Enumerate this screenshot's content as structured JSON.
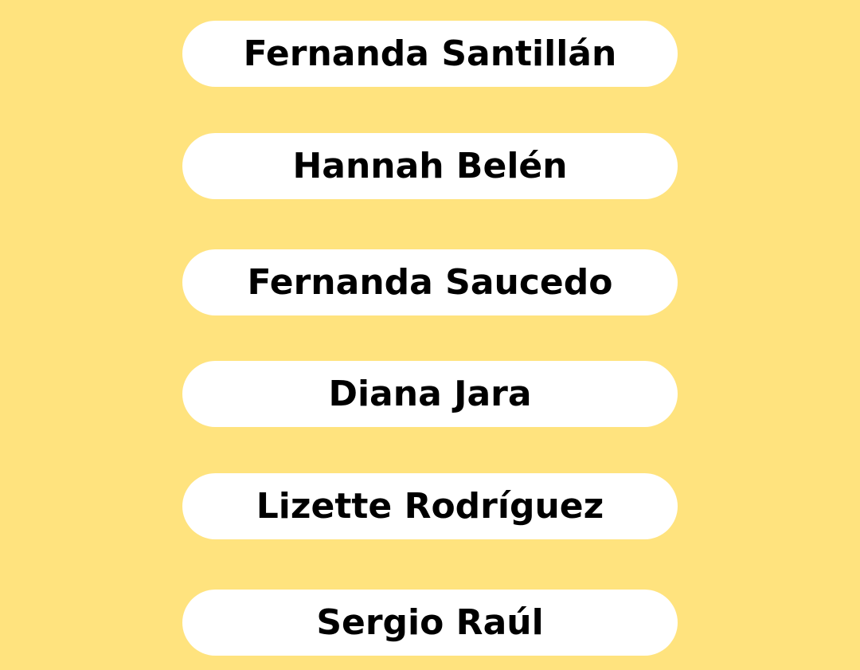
{
  "colors": {
    "background": "#FFE37E",
    "pill": "#FFFFFF",
    "text": "#000000"
  },
  "names": [
    {
      "label": "Fernanda Santillán"
    },
    {
      "label": "Hannah Belén"
    },
    {
      "label": "Fernanda Saucedo"
    },
    {
      "label": "Diana Jara"
    },
    {
      "label": "Lizette Rodríguez"
    },
    {
      "label": "Sergio Raúl"
    }
  ]
}
